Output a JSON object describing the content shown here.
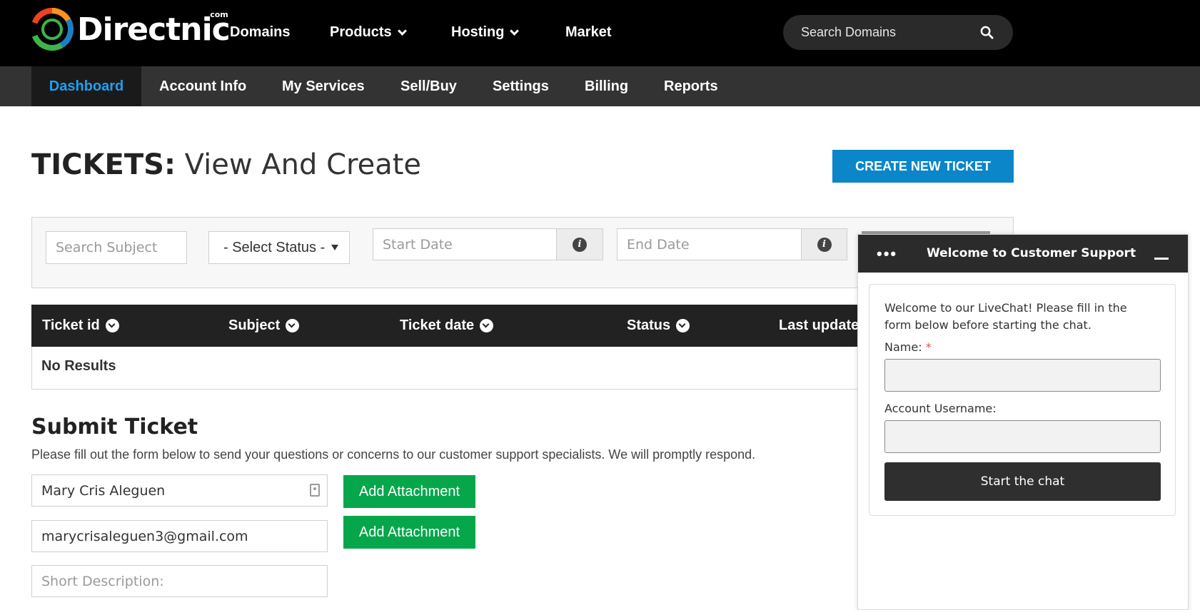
{
  "header": {
    "logo_text": "Directnic",
    "logo_com": "com",
    "nav": [
      {
        "label": "Domains"
      },
      {
        "label": "Products"
      },
      {
        "label": "Hosting"
      },
      {
        "label": "Market"
      }
    ],
    "search_placeholder": "Search Domains"
  },
  "subnav": {
    "items": [
      {
        "label": "Dashboard",
        "active": true
      },
      {
        "label": "Account Info"
      },
      {
        "label": "My Services"
      },
      {
        "label": "Sell/Buy"
      },
      {
        "label": "Settings"
      },
      {
        "label": "Billing"
      },
      {
        "label": "Reports"
      }
    ]
  },
  "page": {
    "title_bold": "TICKETS:",
    "title_light": "View And Create",
    "create_button": "CREATE NEW TICKET"
  },
  "filters": {
    "search_subject_placeholder": "Search Subject",
    "status_select": "- Select Status -",
    "start_date_placeholder": "Start Date",
    "end_date_placeholder": "End Date"
  },
  "table": {
    "columns": [
      "Ticket id",
      "Subject",
      "Ticket date",
      "Status",
      "Last update"
    ],
    "empty_text": "No Results"
  },
  "submit": {
    "title": "Submit Ticket",
    "description": "Please fill out the form below to send your questions or concerns to our customer support specialists. We will promptly respond.",
    "name_value": "Mary Cris Aleguen",
    "email_value": "marycrisaleguen3@gmail.com",
    "short_desc_placeholder": "Short Description:",
    "attachment_label": "Add Attachment"
  },
  "chat": {
    "dots": "•••",
    "title": "Welcome to Customer Support",
    "welcome_text": "Welcome to our LiveChat! Please fill in the form below before starting the chat.",
    "name_label": "Name:",
    "required_mark": "*",
    "username_label": "Account Username:",
    "start_button": "Start the chat"
  },
  "colors": {
    "brand_blue": "#0a86c9",
    "active_tab": "#1da1f2",
    "green": "#06a74b",
    "dark": "#222222"
  }
}
